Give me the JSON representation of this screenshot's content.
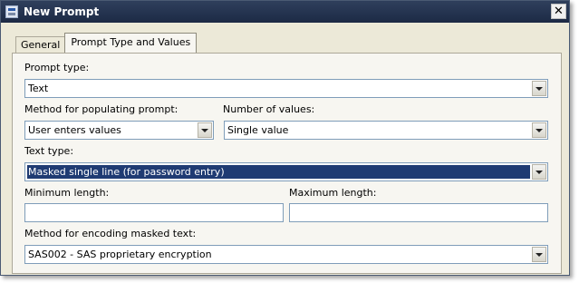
{
  "window": {
    "title": "New Prompt",
    "close_glyph": "✕"
  },
  "tabs": [
    {
      "label": "General",
      "active": false
    },
    {
      "label": "Prompt Type and Values",
      "active": true
    }
  ],
  "form": {
    "prompt_type": {
      "label": "Prompt type:",
      "value": "Text"
    },
    "populate_method": {
      "label": "Method for populating prompt:",
      "value": "User enters values"
    },
    "num_values": {
      "label": "Number of values:",
      "value": "Single value"
    },
    "text_type": {
      "label": "Text type:",
      "value": "Masked single line (for password entry)"
    },
    "min_length": {
      "label": "Minimum length:",
      "value": ""
    },
    "max_length": {
      "label": "Maximum length:",
      "value": ""
    },
    "encoding": {
      "label": "Method for encoding masked text:",
      "value": "SAS002 - SAS proprietary encryption"
    }
  },
  "colors": {
    "titlebar": "#1c2a45",
    "selection": "#1f3b73",
    "dialog_bg": "#ece9d8"
  }
}
